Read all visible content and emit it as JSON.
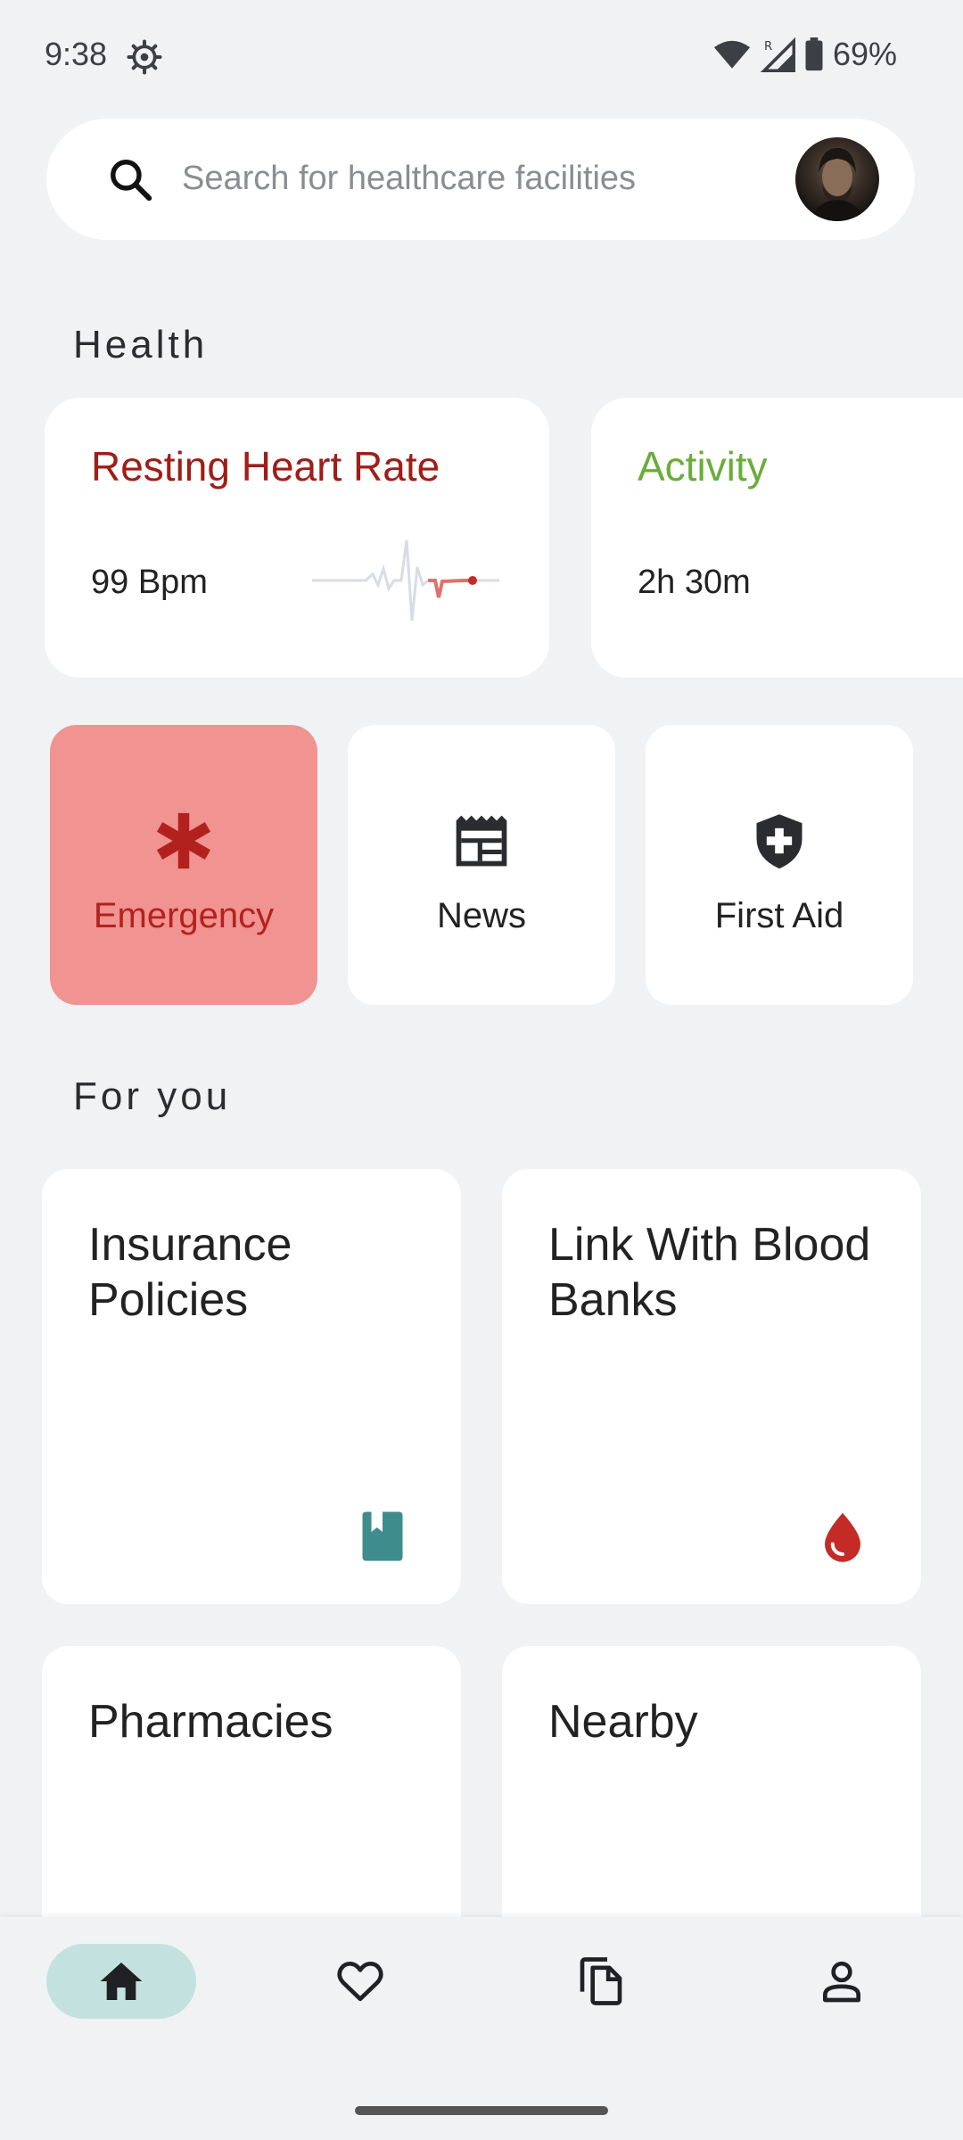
{
  "status_bar": {
    "time": "9:38",
    "battery_percent": "69%",
    "network_label": "R"
  },
  "search": {
    "placeholder": "Search for healthcare facilities"
  },
  "sections": {
    "health": "Health",
    "for_you": "For you"
  },
  "health_cards": [
    {
      "title": "Resting Heart Rate",
      "value": "99 Bpm",
      "title_color": "#a01d18"
    },
    {
      "title": "Activity",
      "value": "2h 30m",
      "title_color": "#6aad3a"
    }
  ],
  "quick_tiles": [
    {
      "label": "Emergency",
      "icon": "asterisk-icon"
    },
    {
      "label": "News",
      "icon": "newspaper-icon"
    },
    {
      "label": "First Aid",
      "icon": "shield-plus-icon"
    }
  ],
  "for_you_cards": [
    {
      "title": "Insurance Policies",
      "icon": "book-icon"
    },
    {
      "title": "Link With Blood Banks",
      "icon": "blood-drop-icon"
    },
    {
      "title": "Pharmacies"
    },
    {
      "title": "Nearby"
    }
  ],
  "bottom_nav": [
    {
      "name": "home",
      "icon": "home-icon",
      "active": true
    },
    {
      "name": "favorites",
      "icon": "heart-icon",
      "active": false
    },
    {
      "name": "documents",
      "icon": "copy-icon",
      "active": false
    },
    {
      "name": "profile",
      "icon": "person-icon",
      "active": false
    }
  ],
  "colors": {
    "accent_teal": "#c3e2df",
    "emergency_bg": "#f09391",
    "emergency_text": "#b3211e",
    "heart_rate_red": "#a01d18",
    "activity_green": "#6aad3a",
    "book_teal": "#3f8c8c",
    "blood_red": "#c42b26"
  }
}
